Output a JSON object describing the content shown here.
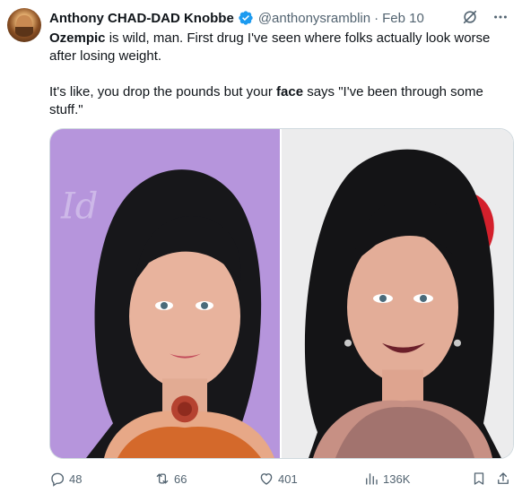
{
  "author": {
    "display_name": "Anthony CHAD-DAD Knobbe",
    "handle": "@anthonysramblin",
    "separator": "·",
    "date": "Feb 10"
  },
  "tweet": {
    "line1_bold": "Ozempic",
    "line1_rest": " is wild, man. First drug I've seen where folks actually look worse after losing weight.",
    "line2_start": "It's like, you drop the pounds but your ",
    "line2_bold": "face",
    "line2_end": " says \"I've been through some stuff.\""
  },
  "media": {
    "left_photo_icon": "photo-before",
    "right_photo_icon": "photo-after"
  },
  "actions": {
    "replies": "48",
    "reposts": "66",
    "likes": "401",
    "views": "136K"
  },
  "colors": {
    "text": "#0f1419",
    "muted": "#536471",
    "verified": "#1d9bf0",
    "border": "#cfd9de"
  }
}
